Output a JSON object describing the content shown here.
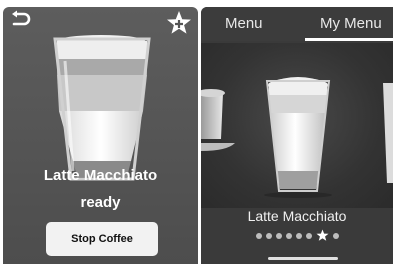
{
  "left_screen": {
    "product_name": "Latte Macchiato",
    "status": "ready",
    "stop_button_label": "Stop Coffee",
    "icons": {
      "back": "back-arrow-icon",
      "favorite": "star-plus-icon"
    }
  },
  "right_screen": {
    "tabs": [
      {
        "label": "Menu",
        "selected": false
      },
      {
        "label": "My Menu",
        "selected": true
      }
    ],
    "current_product": "Latte Macchiato",
    "pagination": {
      "total": 8,
      "current": 7,
      "current_icon": "star-icon"
    }
  }
}
